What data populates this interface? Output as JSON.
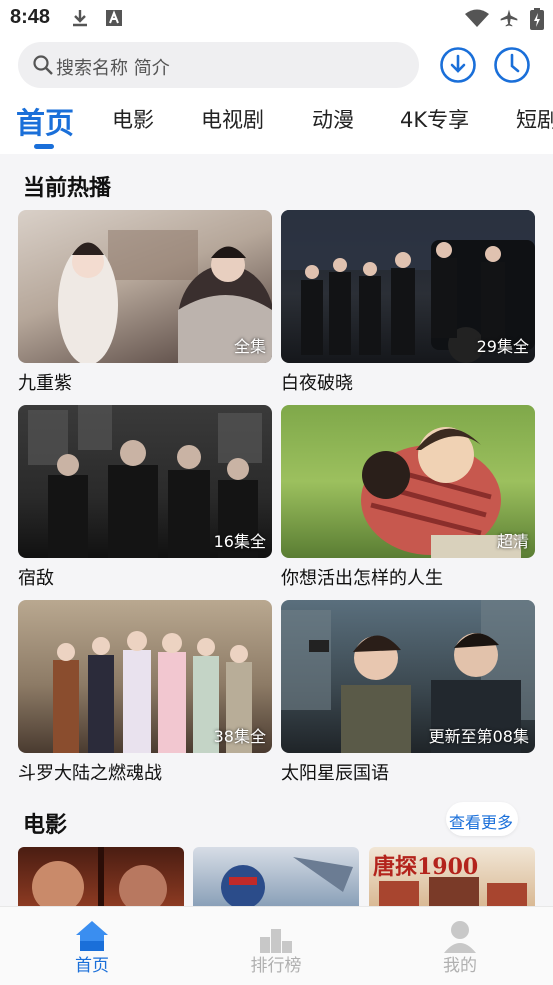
{
  "status_bar": {
    "time": "8:48"
  },
  "search": {
    "placeholder": "搜索名称 简介"
  },
  "tabs": [
    "首页",
    "电影",
    "电视剧",
    "动漫",
    "4K专享",
    "短剧"
  ],
  "sections": [
    {
      "title": "当前热播",
      "items": [
        {
          "title": "九重紫",
          "badge": "全集"
        },
        {
          "title": "白夜破晓",
          "badge": "29集全"
        },
        {
          "title": "宿敌",
          "badge": "16集全"
        },
        {
          "title": "你想活出怎样的人生",
          "badge": "超清"
        },
        {
          "title": "斗罗大陆之燃魂战",
          "badge": "38集全"
        },
        {
          "title": "太阳星辰国语",
          "badge": "更新至第08集"
        }
      ]
    },
    {
      "title": "电影",
      "more_label": "查看更多",
      "poster_texts": [
        "唐探1900"
      ]
    }
  ],
  "bottom_nav": [
    {
      "label": "首页",
      "icon": "home-icon",
      "active": true
    },
    {
      "label": "排行榜",
      "icon": "podium-icon",
      "active": false
    },
    {
      "label": "我的",
      "icon": "user-icon",
      "active": false
    }
  ],
  "colors": {
    "accent": "#1a6fd9",
    "background": "#f5f5f7",
    "inactive": "#b0b0b0"
  }
}
